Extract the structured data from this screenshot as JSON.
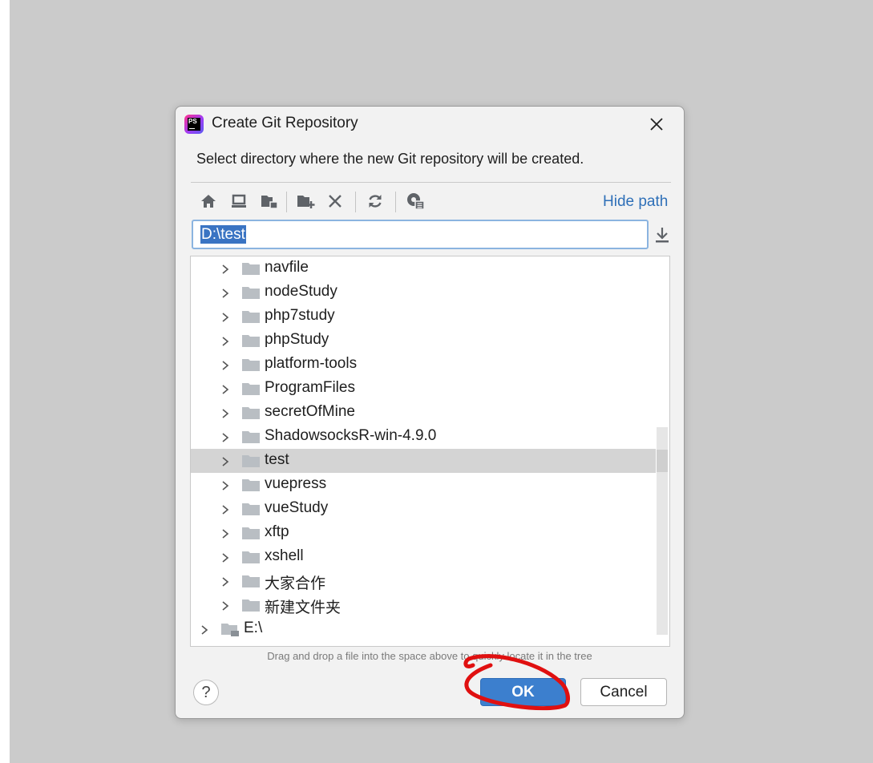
{
  "dialog": {
    "title": "Create Git Repository",
    "description": "Select directory where the new Git repository will be created."
  },
  "toolbar": {
    "buttons": [
      {
        "name": "home-icon"
      },
      {
        "name": "desktop-icon"
      },
      {
        "name": "project-folder-icon"
      },
      {
        "name": "new-folder-icon"
      },
      {
        "name": "delete-icon"
      },
      {
        "name": "refresh-icon"
      },
      {
        "name": "show-hidden-icon"
      }
    ],
    "hide_path_label": "Hide path"
  },
  "path_input": {
    "value": "D:\\test"
  },
  "tree": {
    "items": [
      {
        "label": "navfile",
        "level": 1
      },
      {
        "label": "nodeStudy",
        "level": 1
      },
      {
        "label": "php7study",
        "level": 1
      },
      {
        "label": "phpStudy",
        "level": 1
      },
      {
        "label": "platform-tools",
        "level": 1
      },
      {
        "label": "ProgramFiles",
        "level": 1
      },
      {
        "label": "secretOfMine",
        "level": 1
      },
      {
        "label": "ShadowsocksR-win-4.9.0",
        "level": 1
      },
      {
        "label": "test",
        "level": 1,
        "selected": true
      },
      {
        "label": "vuepress",
        "level": 1
      },
      {
        "label": "vueStudy",
        "level": 1
      },
      {
        "label": "xftp",
        "level": 1
      },
      {
        "label": "xshell",
        "level": 1
      },
      {
        "label": "大家合作",
        "level": 1
      },
      {
        "label": "新建文件夹",
        "level": 1
      },
      {
        "label": "E:\\",
        "level": 0,
        "drive": true
      }
    ]
  },
  "hint": "Drag and drop a file into the space above to quickly locate it in the tree",
  "buttons": {
    "ok": "OK",
    "cancel": "Cancel",
    "help": "?"
  },
  "colors": {
    "backdrop": "#cbcbcb",
    "dialog_bg": "#f2f2f2",
    "accent": "#3c7fce",
    "link": "#2f70b8",
    "selection": "#d4d4d4",
    "annotation": "#e01010"
  }
}
